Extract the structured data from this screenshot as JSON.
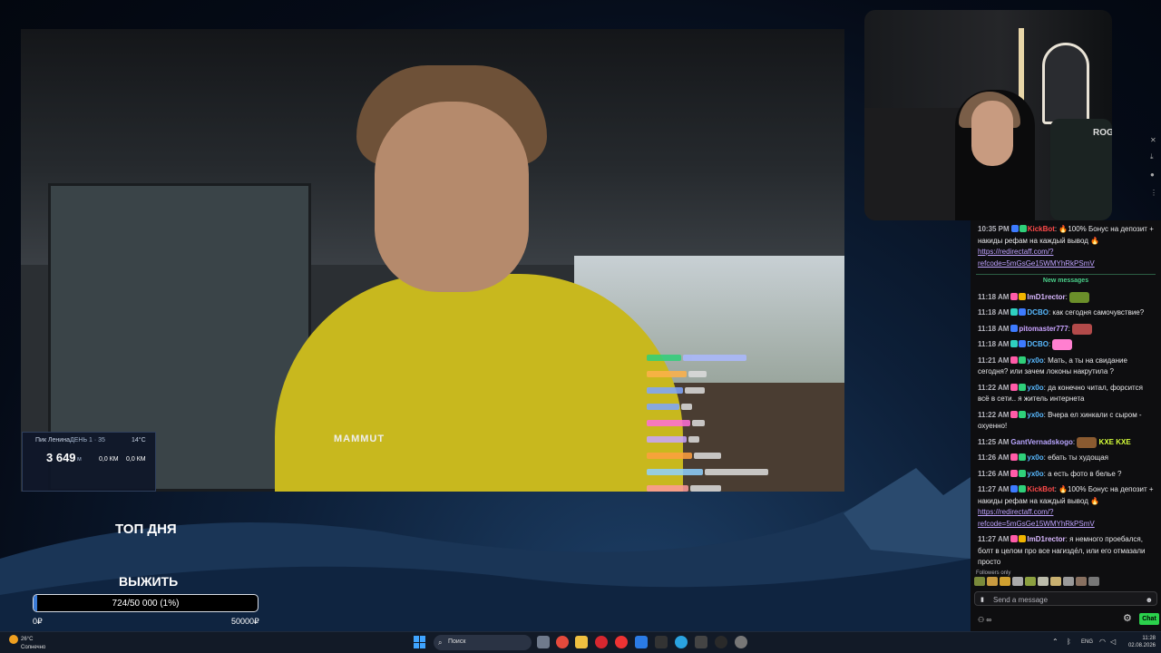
{
  "overlay": {
    "top_label": "ТОП ДНЯ",
    "goal_label": "ВЫЖИТЬ",
    "progress_text": "724/50 000 (1%)",
    "progress_fraction": 0.0145,
    "min_label": "0₽",
    "max_label": "50000₽"
  },
  "hud": {
    "title": "Пик Ленина",
    "day": "ДЕНЬ 1 · 35",
    "temp": "14°C",
    "big_value": "3 649",
    "unit": "м",
    "km1": "0,0 КМ",
    "km2": "0,0 КМ"
  },
  "video": {
    "brand": "MAMMUT",
    "cam_brand": "ROG"
  },
  "chat": {
    "new_messages": "New messages",
    "followers_only": "Followers only",
    "placeholder": "Send a message",
    "chat_button": "Chat",
    "points": "∞",
    "messages": [
      {
        "time": "10:35 PM",
        "user": "KickBot",
        "color": "#ff4a4a",
        "text": "🔥100% Бонус на депозит + накиды рефам на каждый вывод 🔥",
        "link": "https://redirectaff.com/?refcode=5mGsGe15WMYhRkPSmV"
      },
      {
        "time": "11:18 AM",
        "user": "ImD1rector",
        "color": "#d9b8ff",
        "text": ""
      },
      {
        "time": "11:18 AM",
        "user": "DCBO",
        "color": "#58b9ff",
        "text": "как сегодня самочувствие?"
      },
      {
        "time": "11:18 AM",
        "user": "pitomaster777",
        "color": "#c9a3ff",
        "text": ""
      },
      {
        "time": "11:18 AM",
        "user": "DCBO",
        "color": "#58b9ff",
        "text": ""
      },
      {
        "time": "11:21 AM",
        "user": "yx0o",
        "color": "#58b9ff",
        "text": "Мать, а ты на свидание сегодня? или зачем локоны накрутила ?"
      },
      {
        "time": "11:22 AM",
        "user": "yx0o",
        "color": "#58b9ff",
        "text": "да конечно читал, форсится всё в сети.. я житель интернета"
      },
      {
        "time": "11:22 AM",
        "user": "yx0o",
        "color": "#58b9ff",
        "text": "Вчера ел хинкали с сыром - охуенно!"
      },
      {
        "time": "11:25 AM",
        "user": "GantVernadskogo",
        "color": "#b9a6ff",
        "text": "KXE KXE"
      },
      {
        "time": "11:26 AM",
        "user": "yx0o",
        "color": "#58b9ff",
        "text": "ебать ты худощая"
      },
      {
        "time": "11:26 AM",
        "user": "yx0o",
        "color": "#58b9ff",
        "text": "а есть фото в белье ?"
      },
      {
        "time": "11:27 AM",
        "user": "KickBot",
        "color": "#ff4a4a",
        "text": "🔥100% Бонус на депозит + накиды рефам на каждый вывод 🔥",
        "link": "https://redirectaff.com/?refcode=5mGsGe15WMYhRkPSmV"
      },
      {
        "time": "11:27 AM",
        "user": "ImD1rector",
        "color": "#d9b8ff",
        "text": "я немного проебался, болт в целом про все нагизде́л, или его отмазали просто"
      }
    ]
  },
  "taskbar": {
    "weather_temp": "26°C",
    "weather_desc": "Солнечно",
    "search_label": "Поиск",
    "lang": "ENG",
    "time": "11:28",
    "date": "02.08.2026"
  },
  "colors": {
    "accent_green": "#2bd14c",
    "progress_fill": "#3b7bd6",
    "new_messages": "#4ad08a"
  }
}
